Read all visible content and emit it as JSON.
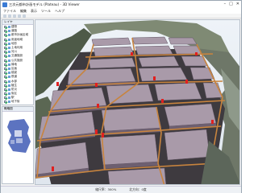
{
  "window": {
    "title": "三次元都市計画モデル (Plateau) - 3D Viewer"
  },
  "menu": [
    "ファイル",
    "編集",
    "表示",
    "ツール",
    "ヘルプ"
  ],
  "layers_panel": {
    "header": "レイヤ",
    "items": [
      "建物",
      "道路",
      "都市計画区域",
      "用途地域",
      "地形",
      "土地利用",
      "河川",
      "交通施設",
      "公共施設",
      "緑地",
      "区画",
      "橋梁",
      "鉄道",
      "水部",
      "植生",
      "防災",
      "街区",
      "駅",
      "地下街",
      "公園",
      "学校",
      "病院",
      "標高",
      "境界",
      "注記"
    ]
  },
  "overview_panel": {
    "header": "概略図"
  },
  "status": {
    "left": "縮尺率：300%",
    "right": "北方向：0度"
  },
  "colors": {
    "building": "#a99aa9",
    "building_side": "#6d5f70",
    "road": "#c8843e",
    "marker": "#e02020",
    "terrain": "#6f7a64"
  }
}
